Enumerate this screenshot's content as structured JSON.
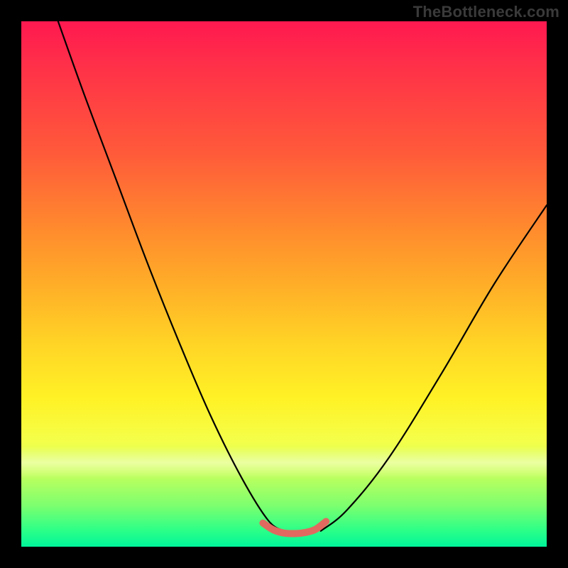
{
  "watermark": "TheBottleneck.com",
  "chart_data": {
    "type": "line",
    "title": "",
    "xlabel": "",
    "ylabel": "",
    "xlim": [
      0,
      100
    ],
    "ylim": [
      0,
      100
    ],
    "grid": false,
    "legend": false,
    "series": [
      {
        "name": "left-arm",
        "stroke": "#000000",
        "x": [
          7,
          12,
          18,
          24,
          30,
          36,
          42,
          47,
          50
        ],
        "y": [
          100,
          86,
          70,
          54,
          39,
          25,
          13,
          5,
          3
        ]
      },
      {
        "name": "right-arm",
        "stroke": "#000000",
        "x": [
          57,
          62,
          70,
          80,
          90,
          100
        ],
        "y": [
          3,
          7,
          17,
          33,
          50,
          65
        ]
      },
      {
        "name": "valley-bottom-highlight",
        "stroke": "#e06a5f",
        "x": [
          46,
          48,
          50,
          52,
          54,
          56,
          58
        ],
        "y": [
          4.5,
          3.2,
          2.6,
          2.5,
          2.7,
          3.3,
          4.8
        ]
      }
    ],
    "background_gradient": {
      "direction": "top-to-bottom",
      "stops": [
        {
          "pos": 0.0,
          "color": "#ff1850"
        },
        {
          "pos": 0.25,
          "color": "#ff5a3a"
        },
        {
          "pos": 0.5,
          "color": "#ffb427"
        },
        {
          "pos": 0.72,
          "color": "#fff226"
        },
        {
          "pos": 0.86,
          "color": "#c4ff5c"
        },
        {
          "pos": 1.0,
          "color": "#00f59a"
        }
      ]
    }
  }
}
